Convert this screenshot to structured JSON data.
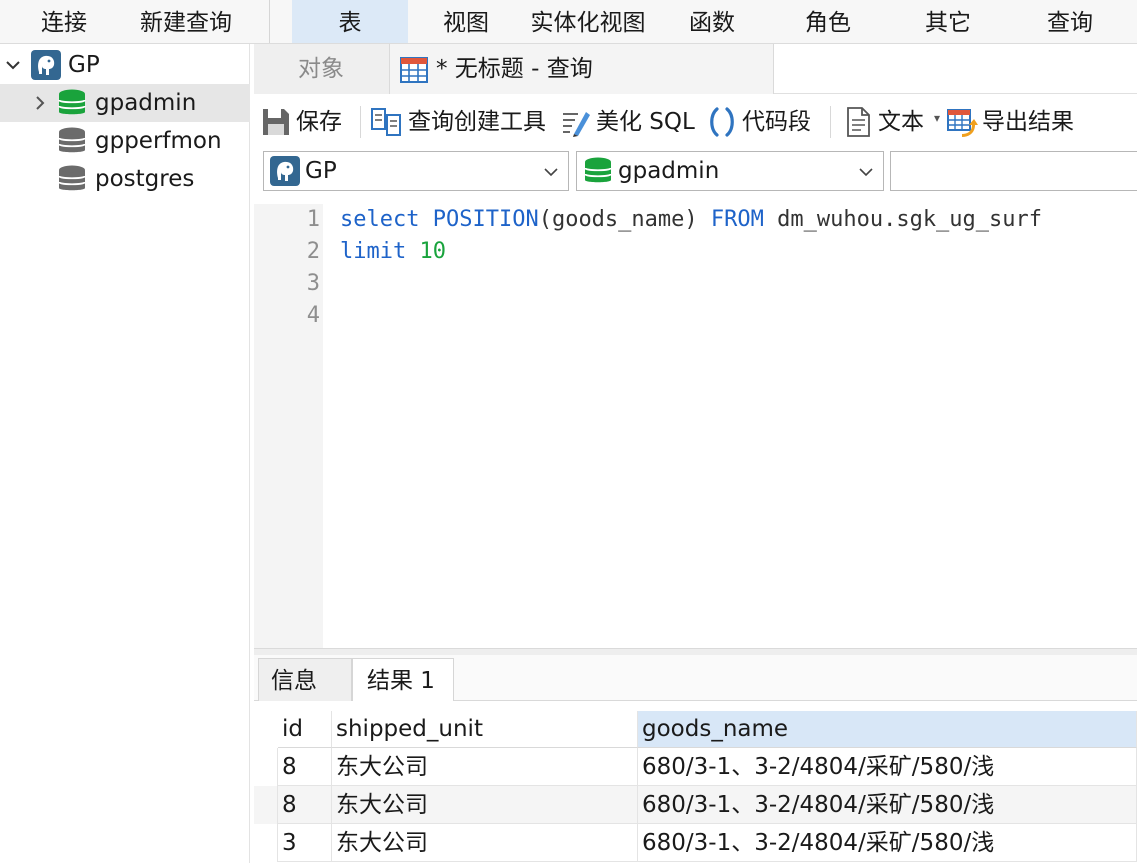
{
  "menu": {
    "items": [
      "连接",
      "新建查询",
      "表",
      "视图",
      "实体化视图",
      "函数",
      "角色",
      "其它",
      "查询"
    ],
    "active": "表"
  },
  "sidebar": {
    "connection": "GP",
    "databases": [
      "gpadmin",
      "gpperfmon",
      "postgres"
    ],
    "selected": "gpadmin"
  },
  "tabs": {
    "objects": "对象",
    "query": "* 无标题 - 查询"
  },
  "toolbar": {
    "save": "保存",
    "query_builder": "查询创建工具",
    "beautify": "美化 SQL",
    "snippet": "代码段",
    "text": "文本",
    "export": "导出结果"
  },
  "selectors": {
    "connection": "GP",
    "database": "gpadmin",
    "schema": ""
  },
  "editor": {
    "line_numbers": [
      "1",
      "2",
      "3",
      "4"
    ],
    "line1": {
      "kw1": "select",
      "kw2": "POSITION",
      "arg": "(goods_name) ",
      "kw3": "FROM",
      "rest": " dm_wuhou.sgk_ug_surf"
    },
    "line2": {
      "kw": "limit",
      "num": "10"
    }
  },
  "result_tabs": [
    "信息",
    "结果 1"
  ],
  "grid": {
    "columns": [
      "id",
      "shipped_unit",
      "goods_name"
    ],
    "selected_column": "goods_name",
    "rows": [
      [
        "8",
        "东大公司",
        "680/3-1、3-2/4804/采矿/580/浅"
      ],
      [
        "8",
        "东大公司",
        "680/3-1、3-2/4804/采矿/580/浅"
      ],
      [
        "3",
        "东大公司",
        "680/3-1、3-2/4804/采矿/580/浅"
      ]
    ]
  },
  "colors": {
    "accent": "#1e63c9",
    "keyword": "#1e63c9",
    "number": "#19a33d",
    "db_green": "#1aa33c",
    "menu_active": "#dce9f7"
  }
}
